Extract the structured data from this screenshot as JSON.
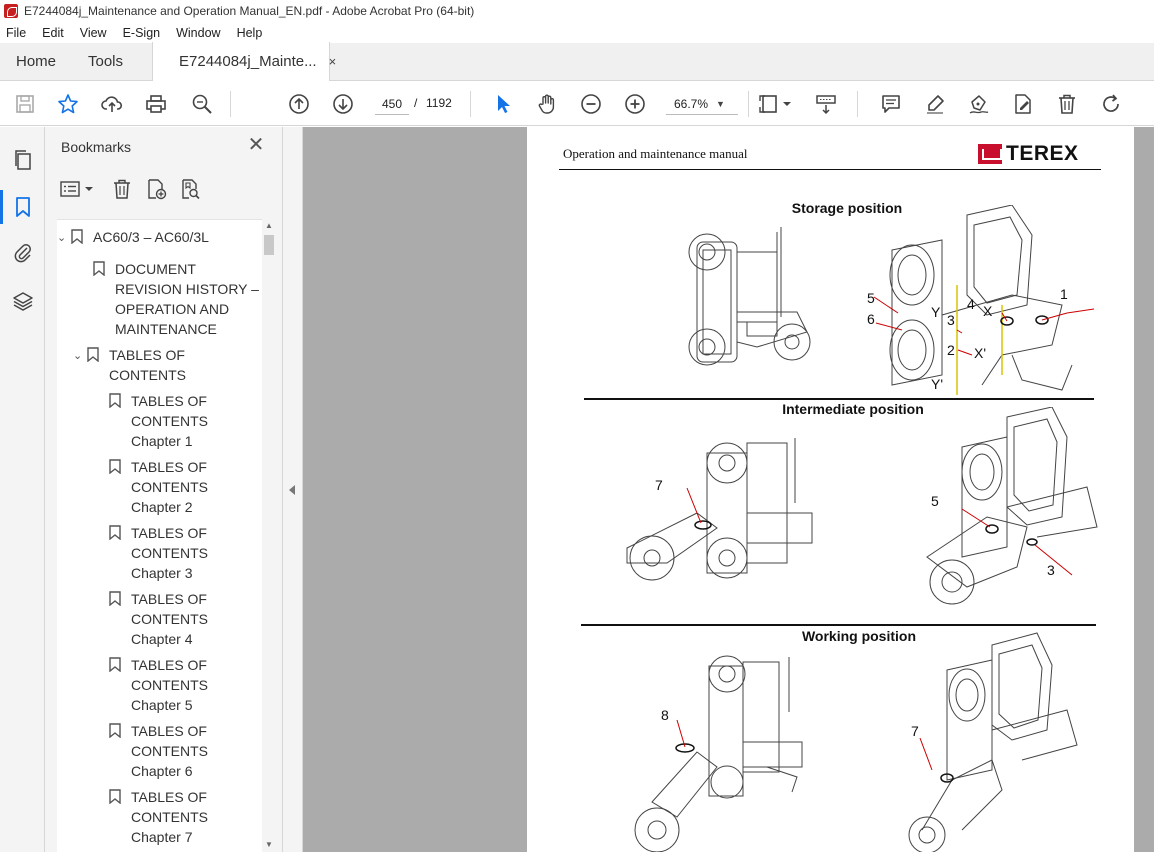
{
  "window": {
    "title": "E7244084j_Maintenance and Operation Manual_EN.pdf - Adobe Acrobat Pro (64-bit)"
  },
  "menu": [
    "File",
    "Edit",
    "View",
    "E-Sign",
    "Window",
    "Help"
  ],
  "tabs": {
    "home": "Home",
    "tools": "Tools",
    "document": "E7244084j_Mainte...",
    "close": "×"
  },
  "toolbar": {
    "current_page": "450",
    "page_separator": "/",
    "total_pages": "1192",
    "zoom": "66.7%"
  },
  "bookmarks": {
    "title": "Bookmarks",
    "close": "✕",
    "items": [
      {
        "label": "AC60/3 – AC60/3L",
        "expanded": true,
        "level": 0
      },
      {
        "label": "DOCUMENT REVISION HISTORY – OPERATION AND MAINTENANCE",
        "level": 1
      },
      {
        "label": "TABLES OF CONTENTS",
        "expanded": true,
        "level": 1
      },
      {
        "label": "TABLES OF CONTENTS Chapter 1",
        "level": 2
      },
      {
        "label": "TABLES OF CONTENTS Chapter 2",
        "level": 2
      },
      {
        "label": "TABLES OF CONTENTS Chapter 3",
        "level": 2
      },
      {
        "label": "TABLES OF CONTENTS Chapter 4",
        "level": 2
      },
      {
        "label": "TABLES OF CONTENTS Chapter 5",
        "level": 2
      },
      {
        "label": "TABLES OF CONTENTS Chapter 6",
        "level": 2
      },
      {
        "label": "TABLES OF CONTENTS Chapter 7",
        "level": 2
      }
    ]
  },
  "document": {
    "header": "Operation and maintenance manual",
    "brand": "TEREX",
    "sections": [
      {
        "title": "Storage position",
        "callouts": [
          "5",
          "6",
          "Y",
          "3",
          "2",
          "Y'",
          "4",
          "X",
          "X'",
          "1"
        ]
      },
      {
        "title": "Intermediate position",
        "callouts": [
          "7",
          "5",
          "3"
        ]
      },
      {
        "title": "Working position",
        "callouts": [
          "8",
          "7"
        ]
      }
    ]
  },
  "colors": {
    "accent": "#1473e6",
    "brand_red": "#c8102e",
    "viewport_bg": "#ababab"
  }
}
